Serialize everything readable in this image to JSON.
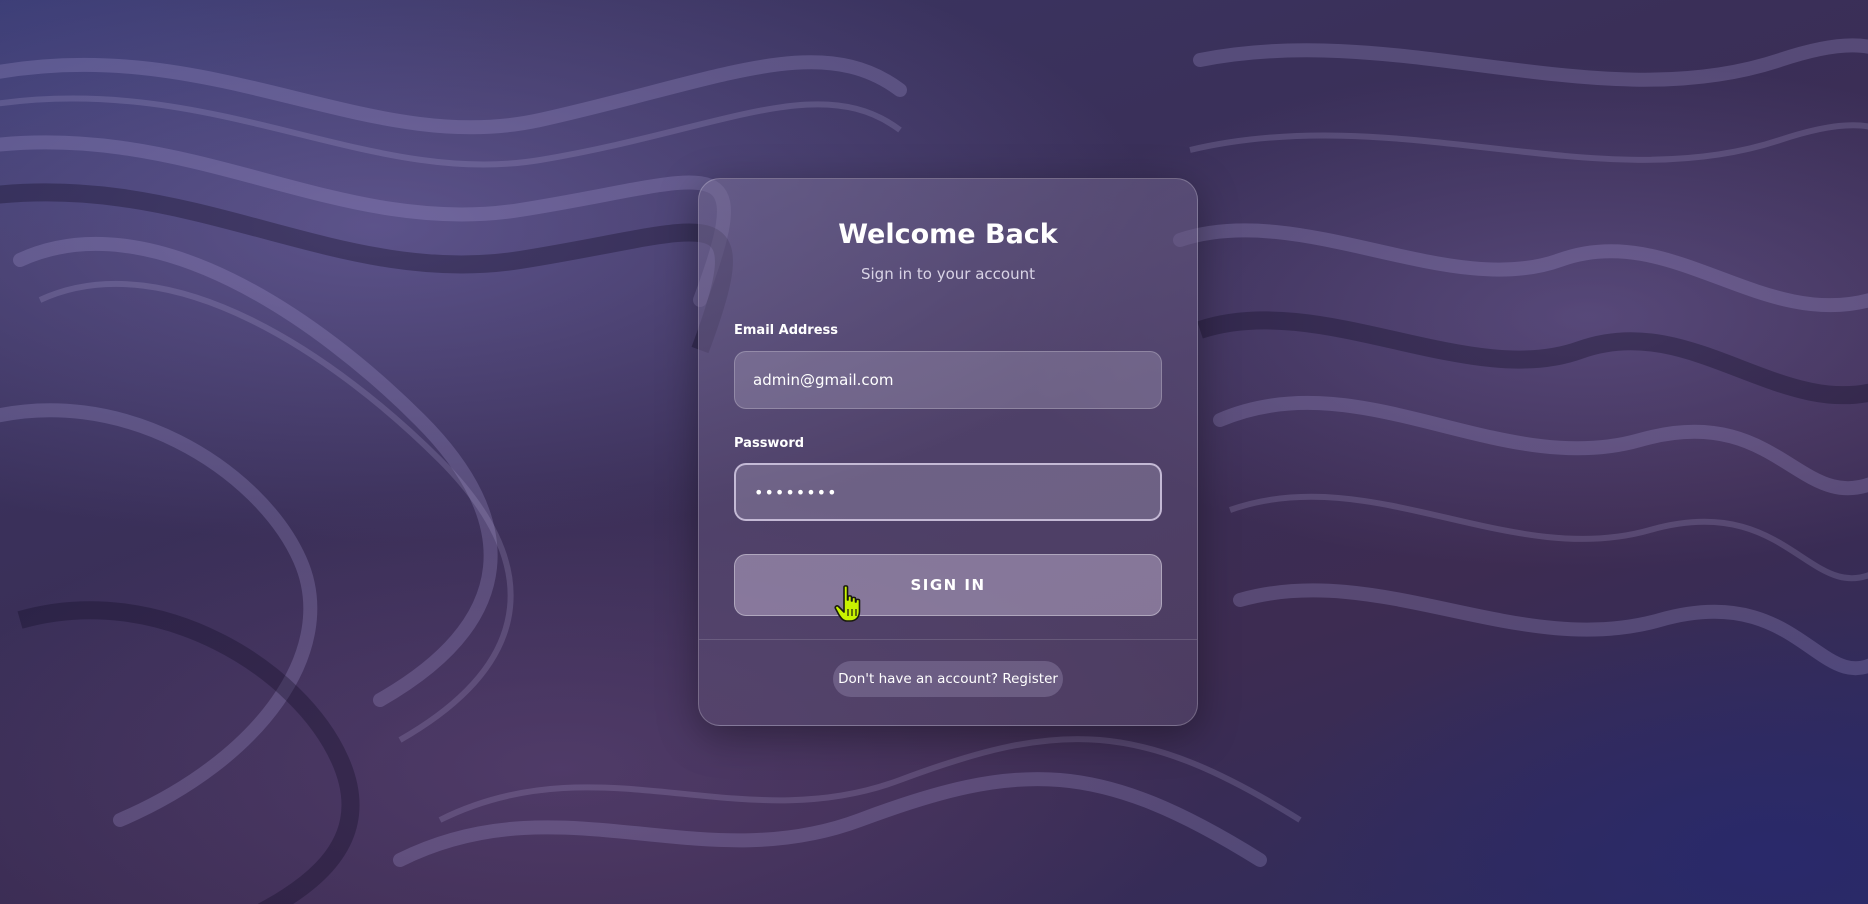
{
  "login": {
    "title": "Welcome Back",
    "subtitle": "Sign in to your account",
    "email_label": "Email Address",
    "email_value": "admin@gmail.com",
    "password_label": "Password",
    "password_value": "••••••••",
    "submit_label": "SIGN IN",
    "register_link": "Don't have an account? Register"
  },
  "icons": {
    "cursor": "hand-pointer-icon"
  },
  "colors": {
    "cursor": "#c8f200"
  }
}
